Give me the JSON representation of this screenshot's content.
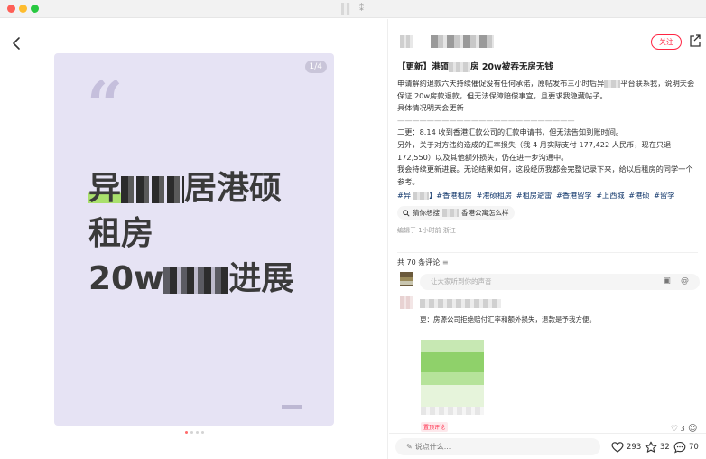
{
  "titlebar": {
    "grip": "⁑"
  },
  "left": {
    "page_badge": "1/4",
    "quote_mark": "“",
    "cover_lines": [
      "异",
      "居港硕",
      "租房",
      "20w",
      "进展"
    ]
  },
  "right": {
    "follow_label": "关注",
    "post_title_prefix": "【更新】港硕",
    "post_title_suffix": "房 20w被吞无房无钱",
    "body_line1": "申请解约退款六天持续催促没有任何承诺，原帖发布三小时后异",
    "body_line1b": "平台联系我，说明天会保证 20w房款退款，但无法保障赔偿事宜，且要求我隐藏帖子。",
    "body_line2": "具体情况明天会更新",
    "body_rule": "————————————————————————",
    "body_line3": "二更：8.14 收到香港汇款公司的汇款申请书，但无法告知到账时间。",
    "body_line4": "另外，关于对方违约造成的汇率损失（我 4 月实际支付 177,422 人民币，现在只退 172,550）以及其他额外损失，仍在进一步沟通中。",
    "body_line5": "我会持续更新进展。无论结果如何，这段经历我都会完整记录下来，给以后租房的同学一个参考。",
    "tags": [
      "#异",
      "】#香港租房",
      "#港硕租房",
      "#租房避雷",
      "#香港留学",
      "#上西城",
      "#港硕",
      "#留学"
    ],
    "search_prefix": "猜你想搜",
    "search_suffix": "香港公寓怎么样",
    "meta": "编辑于 1小时前 浙江",
    "comment_count": "共 70 条评论",
    "comment_placeholder": "让大家听到你的声音",
    "comment_text": "更：房源公司拒绝赔付汇率和额外损失，退款是予我方便。",
    "comment_badge": "置顶评论",
    "comment_likes": "3",
    "say_placeholder": "说点什么...",
    "likes": "293",
    "stars": "32",
    "comments": "70"
  }
}
